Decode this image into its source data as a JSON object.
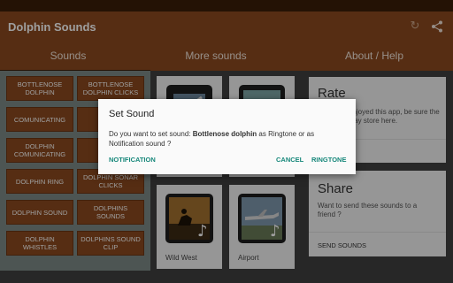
{
  "app": {
    "title": "Dolphin Sounds"
  },
  "icons": {
    "refresh": "refresh-icon",
    "share": "share-icon"
  },
  "tabs": [
    {
      "label": "Sounds"
    },
    {
      "label": "More sounds"
    },
    {
      "label": "About / Help"
    }
  ],
  "sounds": [
    {
      "label": "BOTTLENOSE DOLPHIN"
    },
    {
      "label": "BOTTLENOSE DOLPHIN CLICKS"
    },
    {
      "label": "COMUNICATING"
    },
    {
      "label": "DEL"
    },
    {
      "label": "DOLPHIN COMUNICATING"
    },
    {
      "label": ""
    },
    {
      "label": "DOLPHIN RING"
    },
    {
      "label": "DOLPHIN SONAR CLICKS"
    },
    {
      "label": "DOLPHIN SOUND"
    },
    {
      "label": "DOLPHINS SOUNDS"
    },
    {
      "label": "DOLPHIN WHISTLES"
    },
    {
      "label": "DOLPHINS SOUND CLIP"
    }
  ],
  "more_sounds": [
    {
      "label": ""
    },
    {
      "label": ""
    },
    {
      "label": "Wild West"
    },
    {
      "label": "Airport"
    }
  ],
  "about": {
    "rate": {
      "title": "Rate",
      "text": "enjoyed this app, be sure the play store here."
    },
    "share": {
      "title": "Share",
      "text": "Want to send these sounds to a friend ?",
      "action": "SEND SOUNDS"
    }
  },
  "dialog": {
    "title": "Set Sound",
    "msg_prefix": "Do you want to set sound: ",
    "sound_name": "Bottlenose dolphin",
    "msg_suffix": " as Ringtone or as Notification sound ?",
    "btn_notification": "NOTIFICATION",
    "btn_cancel": "CANCEL",
    "btn_ringtone": "RINGTONE"
  },
  "colors": {
    "brand": "#8b4a1f",
    "accent": "#16877a"
  }
}
